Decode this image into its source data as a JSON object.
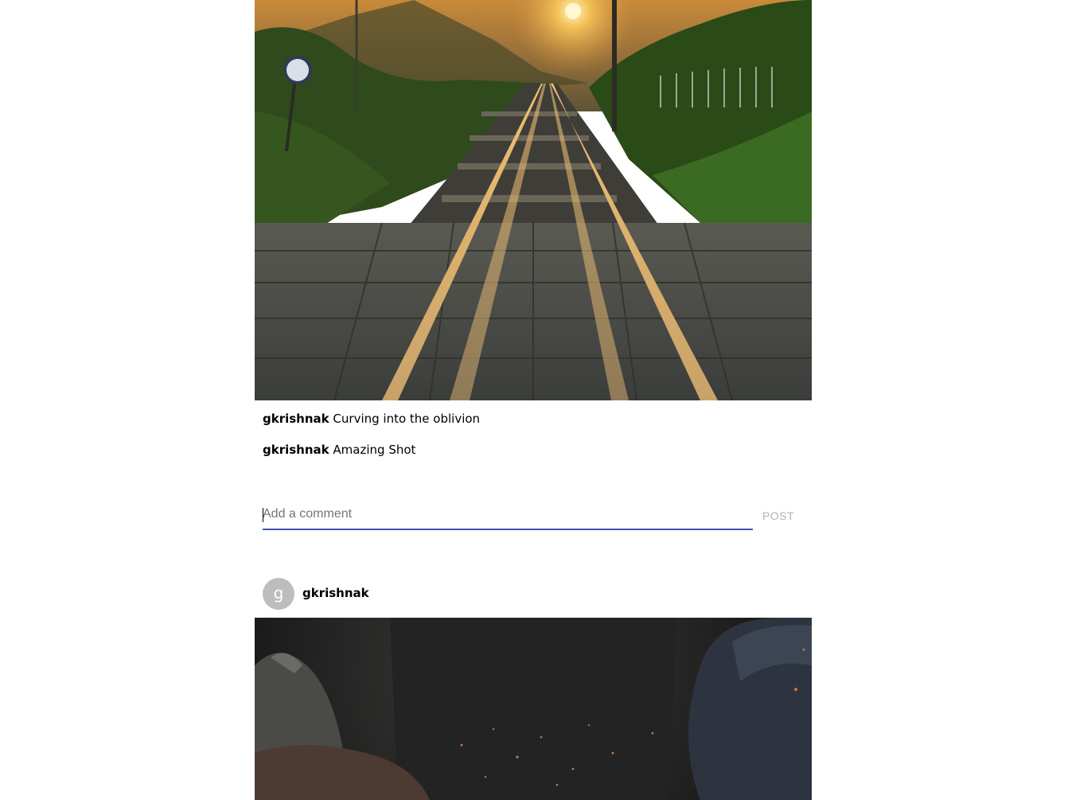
{
  "post1": {
    "image_description_icon": "railway-tracks-sunset-photo",
    "caption": {
      "user": "gkrishnak",
      "text": "Curving into the oblivion"
    },
    "comments": [
      {
        "user": "gkrishnak",
        "text": "Amazing Shot"
      }
    ],
    "comment_form": {
      "placeholder": "Add a comment",
      "value": "",
      "post_label": "POST"
    }
  },
  "post2": {
    "avatar_letter": "g",
    "username": "gkrishnak"
  },
  "colors": {
    "input_underline": "#3f51b5",
    "avatar_bg": "#bdbdbd",
    "post_button_disabled": "#b3b3b3"
  }
}
